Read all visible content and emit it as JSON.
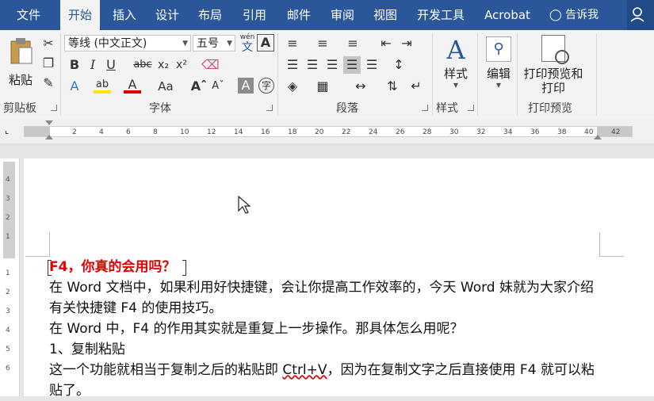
{
  "tabs": [
    "文件",
    "开始",
    "插入",
    "设计",
    "布局",
    "引用",
    "邮件",
    "审阅",
    "视图",
    "开发工具",
    "Acrobat"
  ],
  "tell_me": "告诉我",
  "clipboard": {
    "paste": "粘贴",
    "group": "剪贴板"
  },
  "font": {
    "name": "等线 (中文正文)",
    "size": "五号",
    "wen": "wén",
    "wen2": "文",
    "group": "字体"
  },
  "paragraph": {
    "group": "段落"
  },
  "styles": {
    "label": "样式",
    "group": "样式"
  },
  "editing": {
    "label": "编辑"
  },
  "print": {
    "label1": "打印预览和",
    "label2": "打印",
    "group": "打印预览"
  },
  "ruler": {
    "ticks": [
      "2",
      "4",
      "6",
      "8",
      "10",
      "12",
      "14",
      "16",
      "18",
      "20",
      "22",
      "24",
      "26",
      "28",
      "30",
      "32",
      "34",
      "36",
      "38",
      "40",
      "42"
    ]
  },
  "vruler": {
    "ticks": [
      "4",
      "3",
      "2",
      "1",
      "1",
      "2",
      "3",
      "4",
      "5",
      "6"
    ]
  },
  "document": {
    "title": "F4，你真的会用吗？",
    "p1a": "在 Word 文档中，如果利用好快捷键，会让你提高工作效率的，今天 Word 妹就为大家介绍",
    "p1b": "有关快捷键 F4 的使用技巧。",
    "p2": "在 Word 中，F4 的作用其实就是重复上一步操作。那具体怎么用呢？",
    "p3": "1、复制粘贴",
    "p4a": "这一个功能就相当于复制之后的粘贴即 ",
    "p4b": "Ctrl+V",
    "p4c": "，因为在复制文字之后直接使用 F4 就可以粘",
    "p5": "贴了。"
  }
}
